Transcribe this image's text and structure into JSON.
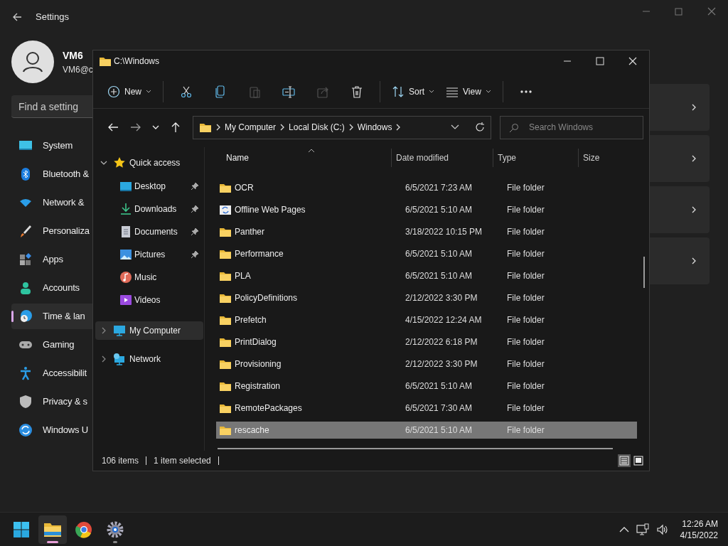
{
  "settings": {
    "title": "Settings",
    "user": {
      "name": "VM6",
      "email": "VM6@c"
    },
    "search": {
      "placeholder": "Find a setting"
    },
    "nav": [
      {
        "label": "System",
        "kind": "system",
        "selected": false
      },
      {
        "label": "Bluetooth &",
        "kind": "bluetooth",
        "selected": false
      },
      {
        "label": "Network &",
        "kind": "network",
        "selected": false
      },
      {
        "label": "Personaliza",
        "kind": "brush",
        "selected": false
      },
      {
        "label": "Apps",
        "kind": "apps",
        "selected": false
      },
      {
        "label": "Accounts",
        "kind": "accounts",
        "selected": false
      },
      {
        "label": "Time & lan",
        "kind": "time",
        "selected": true
      },
      {
        "label": "Gaming",
        "kind": "gaming",
        "selected": false
      },
      {
        "label": "Accessibilit",
        "kind": "accessibility",
        "selected": false
      },
      {
        "label": "Privacy & s",
        "kind": "privacy",
        "selected": false
      },
      {
        "label": "Windows U",
        "kind": "update",
        "selected": false
      }
    ]
  },
  "explorer": {
    "title": "C:\\Windows",
    "toolbar": [
      {
        "kind": "new",
        "label": "New",
        "disabled": false
      },
      {
        "kind": "cut",
        "disabled": false
      },
      {
        "kind": "copy",
        "disabled": false
      },
      {
        "kind": "paste",
        "disabled": true
      },
      {
        "kind": "rename",
        "disabled": false
      },
      {
        "kind": "share",
        "disabled": true
      },
      {
        "kind": "delete",
        "disabled": false
      },
      {
        "kind": "sort",
        "label": "Sort",
        "disabled": false
      },
      {
        "kind": "view",
        "label": "View",
        "disabled": false
      },
      {
        "kind": "more",
        "disabled": false
      }
    ],
    "breadcrumb": [
      "My Computer",
      "Local Disk (C:)",
      "Windows"
    ],
    "search": {
      "placeholder": "Search Windows"
    },
    "tree": [
      {
        "label": "Quick access",
        "kind": "star",
        "expanded": true,
        "selected": false,
        "children": [
          {
            "label": "Desktop",
            "kind": "desktop",
            "pinned": true
          },
          {
            "label": "Downloads",
            "kind": "downloads",
            "pinned": true
          },
          {
            "label": "Documents",
            "kind": "documents",
            "pinned": true
          },
          {
            "label": "Pictures",
            "kind": "pictures",
            "pinned": true
          },
          {
            "label": "Music",
            "kind": "music",
            "pinned": false
          },
          {
            "label": "Videos",
            "kind": "videos",
            "pinned": false
          }
        ]
      },
      {
        "label": "My Computer",
        "kind": "computer",
        "expanded": false,
        "selected": true
      },
      {
        "label": "Network",
        "kind": "network",
        "expanded": false,
        "selected": false
      }
    ],
    "columns": [
      {
        "label": "Name",
        "sorted": true
      },
      {
        "label": "Date modified",
        "sorted": false
      },
      {
        "label": "Type",
        "sorted": false
      },
      {
        "label": "Size",
        "sorted": false
      }
    ],
    "rows": [
      {
        "name": "OCR",
        "kind": "folder",
        "date": "6/5/2021 7:23 AM",
        "type": "File folder",
        "selected": false
      },
      {
        "name": "Offline Web Pages",
        "kind": "special",
        "date": "6/5/2021 5:10 AM",
        "type": "File folder",
        "selected": false
      },
      {
        "name": "Panther",
        "kind": "folder",
        "date": "3/18/2022 10:15 PM",
        "type": "File folder",
        "selected": false
      },
      {
        "name": "Performance",
        "kind": "folder",
        "date": "6/5/2021 5:10 AM",
        "type": "File folder",
        "selected": false
      },
      {
        "name": "PLA",
        "kind": "folder",
        "date": "6/5/2021 5:10 AM",
        "type": "File folder",
        "selected": false
      },
      {
        "name": "PolicyDefinitions",
        "kind": "folder",
        "date": "2/12/2022 3:30 PM",
        "type": "File folder",
        "selected": false
      },
      {
        "name": "Prefetch",
        "kind": "folder",
        "date": "4/15/2022 12:24 AM",
        "type": "File folder",
        "selected": false
      },
      {
        "name": "PrintDialog",
        "kind": "folder",
        "date": "2/12/2022 6:18 PM",
        "type": "File folder",
        "selected": false
      },
      {
        "name": "Provisioning",
        "kind": "folder",
        "date": "2/12/2022 3:30 PM",
        "type": "File folder",
        "selected": false
      },
      {
        "name": "Registration",
        "kind": "folder",
        "date": "6/5/2021 5:10 AM",
        "type": "File folder",
        "selected": false
      },
      {
        "name": "RemotePackages",
        "kind": "folder",
        "date": "6/5/2021 7:30 AM",
        "type": "File folder",
        "selected": false
      },
      {
        "name": "rescache",
        "kind": "folder",
        "date": "6/5/2021 5:10 AM",
        "type": "File folder",
        "selected": true
      }
    ],
    "status": {
      "count": "106 items",
      "selection": "1 item selected"
    },
    "views": [
      {
        "kind": "details",
        "selected": true
      },
      {
        "kind": "tiles",
        "selected": false
      }
    ]
  },
  "taskbar": {
    "apps": [
      {
        "kind": "start",
        "active": false,
        "running": false
      },
      {
        "kind": "explorer",
        "active": true,
        "running": true
      },
      {
        "kind": "browser",
        "active": false,
        "running": false
      },
      {
        "kind": "settings",
        "active": false,
        "running": true
      }
    ],
    "clock": {
      "time": "12:26 AM",
      "date": "4/15/2022"
    }
  }
}
